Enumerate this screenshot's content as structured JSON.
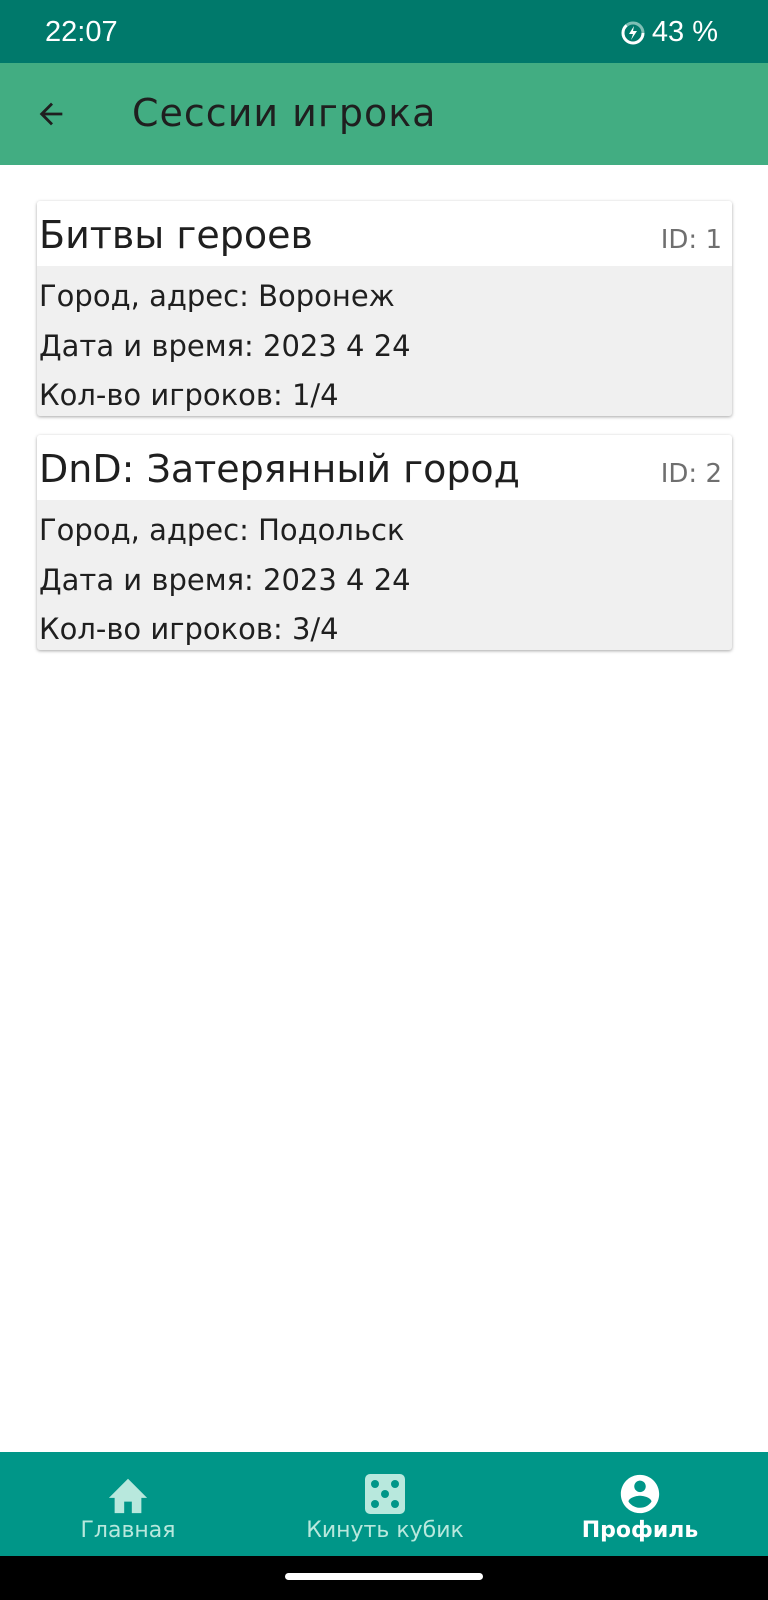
{
  "status_bar": {
    "time": "22:07",
    "battery": "43 %"
  },
  "app_bar": {
    "title": "Сессии игрока"
  },
  "sessions": [
    {
      "title": "Битвы героев",
      "id": "ID: 1",
      "address": "Город, адрес: Воронеж",
      "datetime": "Дата и время: 2023 4 24",
      "players": "Кол-во игроков: 1/4"
    },
    {
      "title": "DnD: Затерянный город",
      "id": "ID: 2",
      "address": "Город, адрес: Подольск",
      "datetime": "Дата и время: 2023 4 24",
      "players": "Кол-во игроков: 3/4"
    }
  ],
  "bottom_nav": {
    "items": [
      {
        "label": "Главная",
        "icon": "home-icon",
        "active": false
      },
      {
        "label": "Кинуть кубик",
        "icon": "dice-icon",
        "active": false
      },
      {
        "label": "Профиль",
        "icon": "account-circle-icon",
        "active": true
      }
    ]
  },
  "colors": {
    "status_bar": "#00796b",
    "app_bar": "#42ad82",
    "bottom_nav": "#009688",
    "nav_inactive": "#b8e8dd",
    "nav_active": "#ffffff"
  }
}
